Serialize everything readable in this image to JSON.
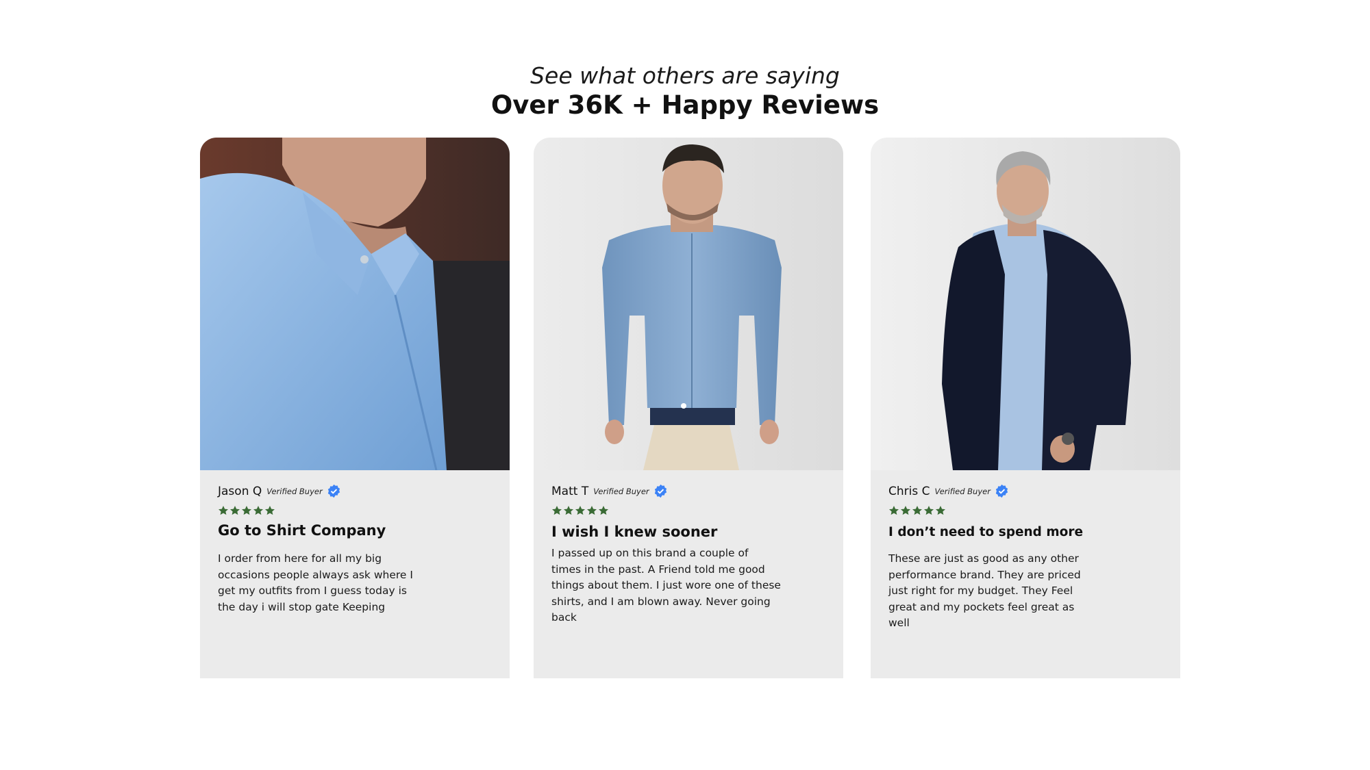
{
  "header": {
    "subtitle": "See what others are saying",
    "title": "Over 36K + Happy Reviews"
  },
  "colors": {
    "star": "#3a6b35",
    "verified_badge": "#3b82f6",
    "card_body": "#ebebeb"
  },
  "reviews": [
    {
      "name": "Jason Q",
      "badge": "Verified Buyer",
      "rating": 5,
      "headline": "Go to Shirt Company",
      "text": "I order from here for all my big occasions people always ask where I get my outfits from I guess today is the day i will stop gate Keeping"
    },
    {
      "name": "Matt T",
      "badge": "Verified Buyer",
      "rating": 5,
      "headline": "I wish I knew sooner",
      "text": "I passed up on this brand a couple of times in the past. A Friend told me good things about them. I just wore one of these shirts, and I am blown away. Never going back"
    },
    {
      "name": "Chris C",
      "badge": "Verified Buyer",
      "rating": 5,
      "headline": "I don’t need to spend more",
      "text": "These are just as good as any other performance brand. They are priced just right for my budget. They Feel great and my pockets feel great as well"
    }
  ]
}
